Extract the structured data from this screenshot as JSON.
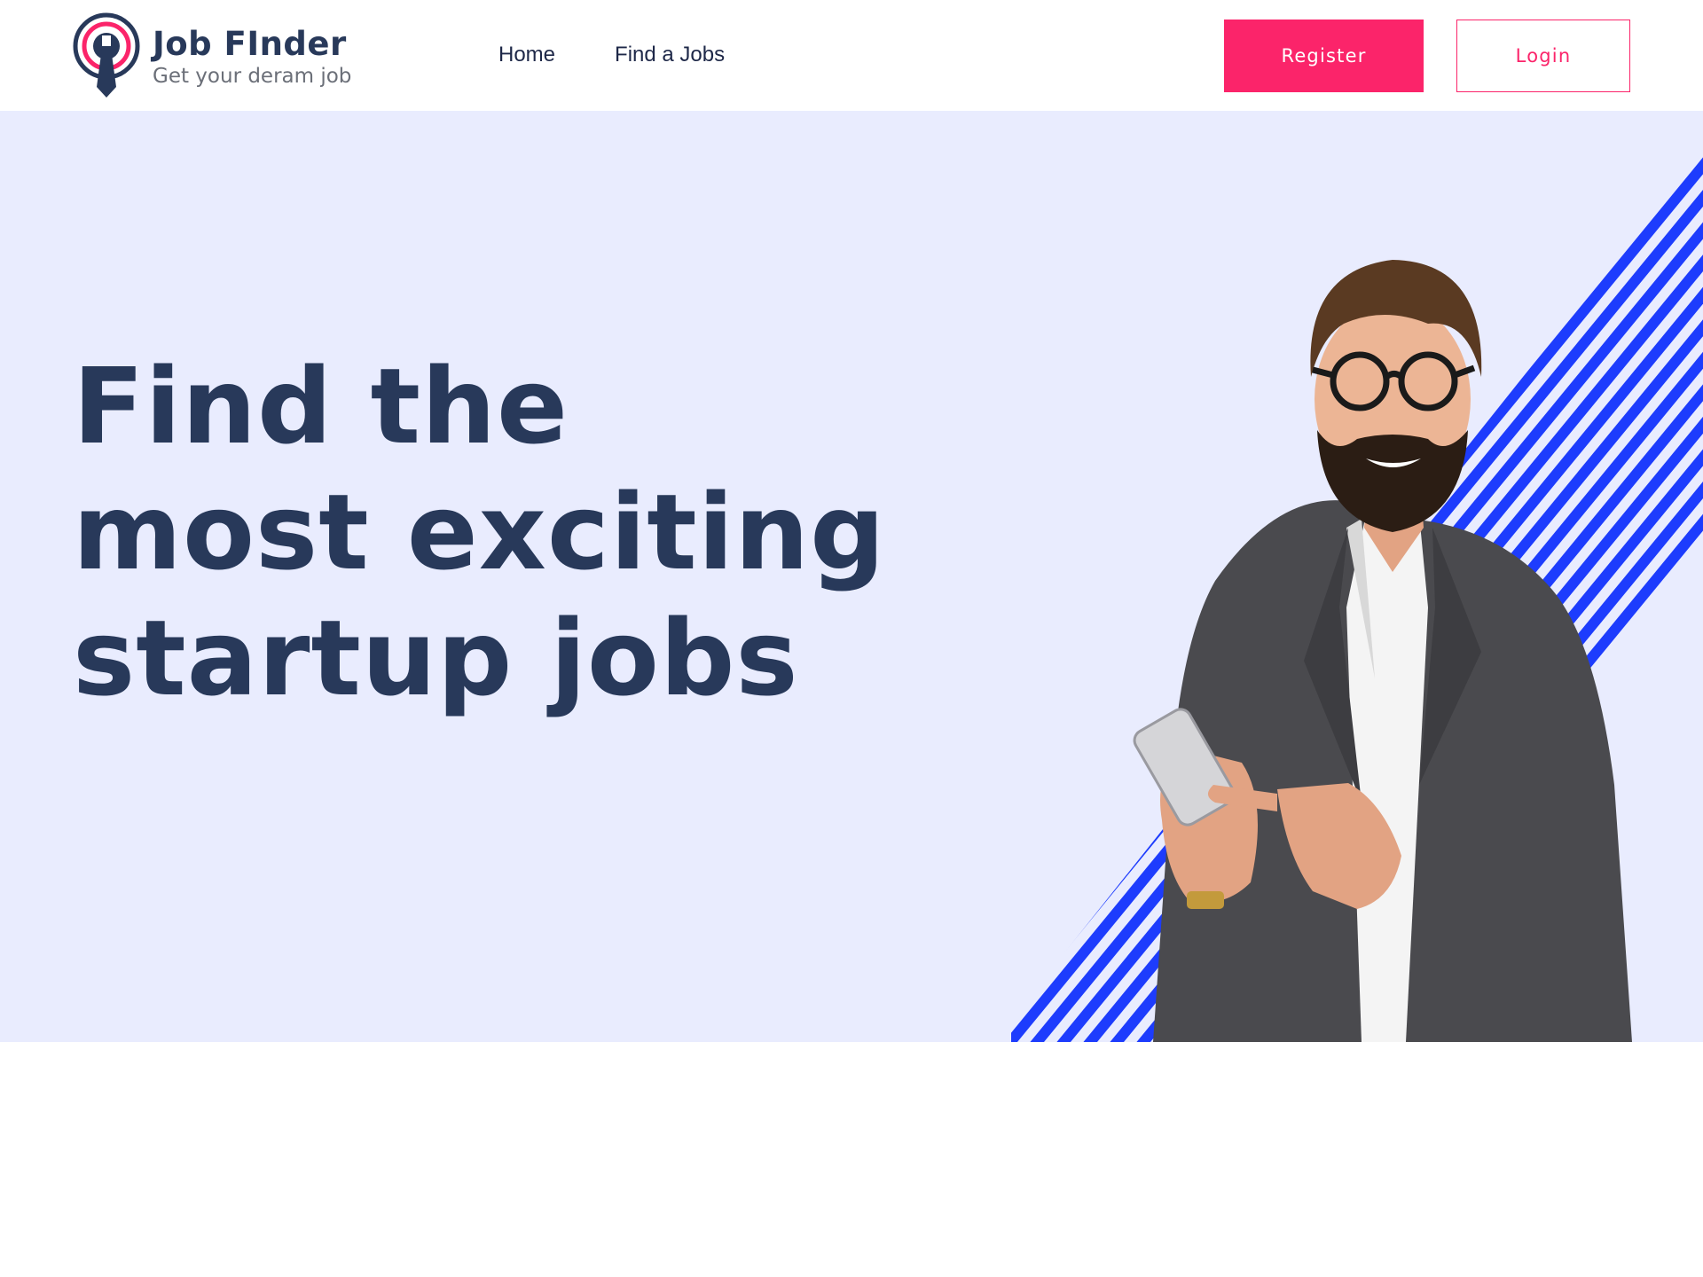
{
  "brand": {
    "name": "Job FInder",
    "tagline": "Get your deram job",
    "accent_color": "#fb246a",
    "text_color": "#28395a",
    "logo_icon": "target-tie-icon"
  },
  "nav": {
    "items": [
      {
        "label": "Home"
      },
      {
        "label": "Find a Jobs"
      }
    ]
  },
  "auth": {
    "register_label": "Register",
    "login_label": "Login"
  },
  "hero": {
    "title_lines": [
      "Find the",
      "most exciting",
      "startup jobs"
    ],
    "background_color": "#e9ecfe",
    "stripe_color": "#1d3cfd",
    "image": "smiling-businessman-with-smartphone"
  }
}
